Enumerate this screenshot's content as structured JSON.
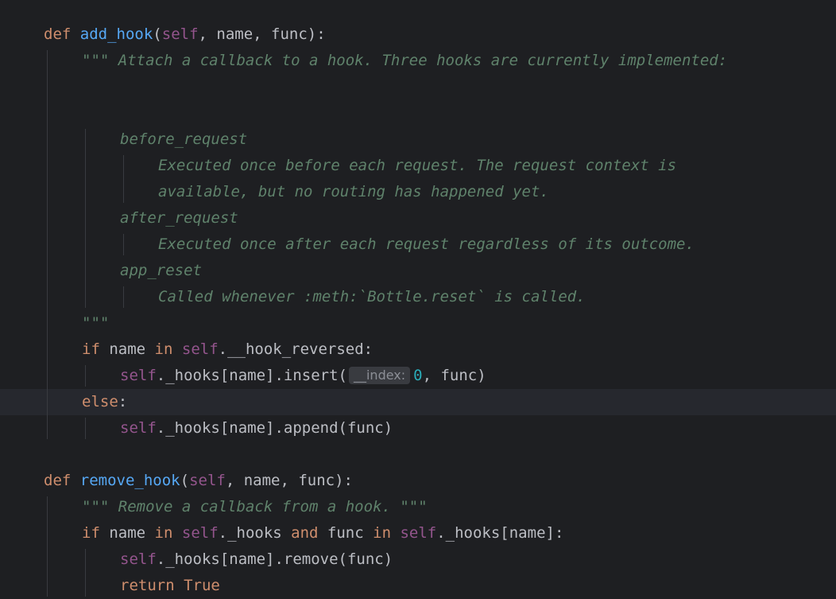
{
  "editor": {
    "lines": [
      {
        "indent": 1,
        "tokens": [
          {
            "t": "def",
            "c": "kw"
          },
          {
            "t": " ",
            "c": "dft"
          },
          {
            "t": "add_hook",
            "c": "fn"
          },
          {
            "t": "(",
            "c": "dft"
          },
          {
            "t": "self",
            "c": "slf"
          },
          {
            "t": ", name, func):",
            "c": "dft"
          }
        ]
      },
      {
        "indent": 2,
        "tokens": [
          {
            "t": "\"\"\" Attach a callback to a hook. Three hooks are currently implemented:",
            "c": "doc"
          }
        ]
      },
      {
        "indent": 2,
        "tokens": []
      },
      {
        "indent": 2,
        "tokens": []
      },
      {
        "indent": 3,
        "tokens": [
          {
            "t": "before_request",
            "c": "doc"
          }
        ]
      },
      {
        "indent": 4,
        "tokens": [
          {
            "t": "Executed once before each request. The request context is",
            "c": "doc"
          }
        ]
      },
      {
        "indent": 4,
        "tokens": [
          {
            "t": "available, but no routing has happened yet.",
            "c": "doc"
          }
        ]
      },
      {
        "indent": 3,
        "tokens": [
          {
            "t": "after_request",
            "c": "doc"
          }
        ]
      },
      {
        "indent": 4,
        "tokens": [
          {
            "t": "Executed once after each request regardless of its outcome.",
            "c": "doc"
          }
        ]
      },
      {
        "indent": 3,
        "tokens": [
          {
            "t": "app_reset",
            "c": "doc"
          }
        ]
      },
      {
        "indent": 4,
        "tokens": [
          {
            "t": "Called whenever :meth:`Bottle.reset` is called.",
            "c": "doc"
          }
        ]
      },
      {
        "indent": 2,
        "tokens": [
          {
            "t": "\"\"\"",
            "c": "doc"
          }
        ]
      },
      {
        "indent": 2,
        "tokens": [
          {
            "t": "if",
            "c": "kw"
          },
          {
            "t": " name ",
            "c": "dft"
          },
          {
            "t": "in",
            "c": "kw"
          },
          {
            "t": " ",
            "c": "dft"
          },
          {
            "t": "self",
            "c": "slf"
          },
          {
            "t": ".__hook_reversed:",
            "c": "dft"
          }
        ]
      },
      {
        "indent": 3,
        "tokens": [
          {
            "t": "self",
            "c": "slf"
          },
          {
            "t": "._hooks[name].insert(",
            "c": "dft"
          },
          {
            "t": "__index:",
            "c": "hint"
          },
          {
            "t": "0",
            "c": "num"
          },
          {
            "t": ", func)",
            "c": "dft"
          }
        ]
      },
      {
        "indent": 2,
        "current": true,
        "tokens": [
          {
            "t": "else",
            "c": "kw"
          },
          {
            "t": ":",
            "c": "dft"
          }
        ]
      },
      {
        "indent": 3,
        "tokens": [
          {
            "t": "self",
            "c": "slf"
          },
          {
            "t": "._hooks[name].append(func)",
            "c": "dft"
          }
        ]
      },
      {
        "indent": 1,
        "tokens": []
      },
      {
        "indent": 1,
        "tokens": [
          {
            "t": "def",
            "c": "kw"
          },
          {
            "t": " ",
            "c": "dft"
          },
          {
            "t": "remove_hook",
            "c": "fn"
          },
          {
            "t": "(",
            "c": "dft"
          },
          {
            "t": "self",
            "c": "slf"
          },
          {
            "t": ", name, func):",
            "c": "dft"
          }
        ]
      },
      {
        "indent": 2,
        "tokens": [
          {
            "t": "\"\"\" Remove a callback from a hook. \"\"\"",
            "c": "doc"
          }
        ]
      },
      {
        "indent": 2,
        "tokens": [
          {
            "t": "if",
            "c": "kw"
          },
          {
            "t": " name ",
            "c": "dft"
          },
          {
            "t": "in",
            "c": "kw"
          },
          {
            "t": " ",
            "c": "dft"
          },
          {
            "t": "self",
            "c": "slf"
          },
          {
            "t": "._hooks ",
            "c": "dft"
          },
          {
            "t": "and",
            "c": "kw"
          },
          {
            "t": " func ",
            "c": "dft"
          },
          {
            "t": "in",
            "c": "kw"
          },
          {
            "t": " ",
            "c": "dft"
          },
          {
            "t": "self",
            "c": "slf"
          },
          {
            "t": "._hooks[name]:",
            "c": "dft"
          }
        ]
      },
      {
        "indent": 3,
        "tokens": [
          {
            "t": "self",
            "c": "slf"
          },
          {
            "t": "._hooks[name].remove(func)",
            "c": "dft"
          }
        ]
      },
      {
        "indent": 3,
        "tokens": [
          {
            "t": "return",
            "c": "kw"
          },
          {
            "t": " ",
            "c": "dft"
          },
          {
            "t": "True",
            "c": "kw"
          }
        ]
      }
    ]
  },
  "colors": {
    "background": "#1e1f22",
    "current_line": "#26282e",
    "keyword": "#cf8e6d",
    "function": "#56a8f5",
    "self": "#94558d",
    "number": "#2aacb8",
    "docstring": "#5f826b",
    "default": "#bcbec4",
    "indent_guide": "#393b40"
  }
}
